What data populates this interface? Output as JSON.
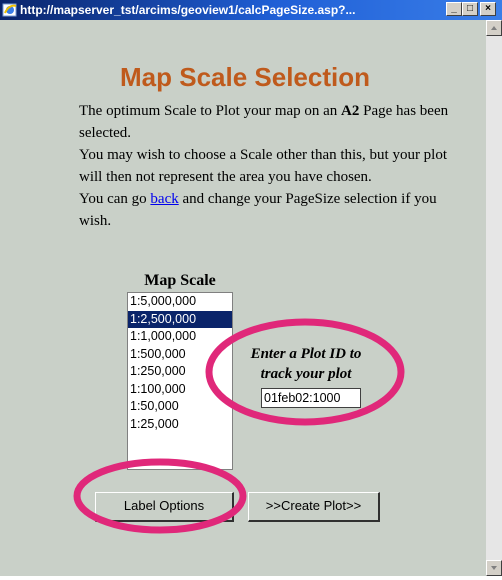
{
  "window": {
    "title": "http://mapserver_tst/arcims/geoview1/calcPageSize.asp?...",
    "controls": {
      "minimize": "_",
      "maximize": "□",
      "close": "×"
    }
  },
  "page": {
    "title": "Map Scale Selection",
    "intro": {
      "line1_a": "The optimum Scale to Plot your map on an ",
      "line1_bold": "A2",
      "line1_b": " Page has been selected.",
      "line2": "You may wish to choose a Scale other than this, but your plot will then not represent the area you have chosen.",
      "line3_a": "You can go ",
      "back_link": "back",
      "line3_b": " and change your PageSize selection if you wish."
    },
    "map_scale": {
      "label": "Map Scale",
      "options": [
        "1:5,000,000",
        "1:2,500,000",
        "1:1,000,000",
        "1:500,000",
        "1:250,000",
        "1:100,000",
        "1:50,000",
        "1:25,000"
      ],
      "selected": "1:2,500,000"
    },
    "plot_id": {
      "label": "Enter a Plot ID to track your plot",
      "value": "01feb02:1000"
    },
    "buttons": {
      "label_options": "Label Options",
      "create_plot": ">>Create Plot>>"
    }
  },
  "colors": {
    "title": "#bf5a1c",
    "background": "#c9d0c8",
    "selection": "#0a246a",
    "annotation": "#e0287a"
  }
}
